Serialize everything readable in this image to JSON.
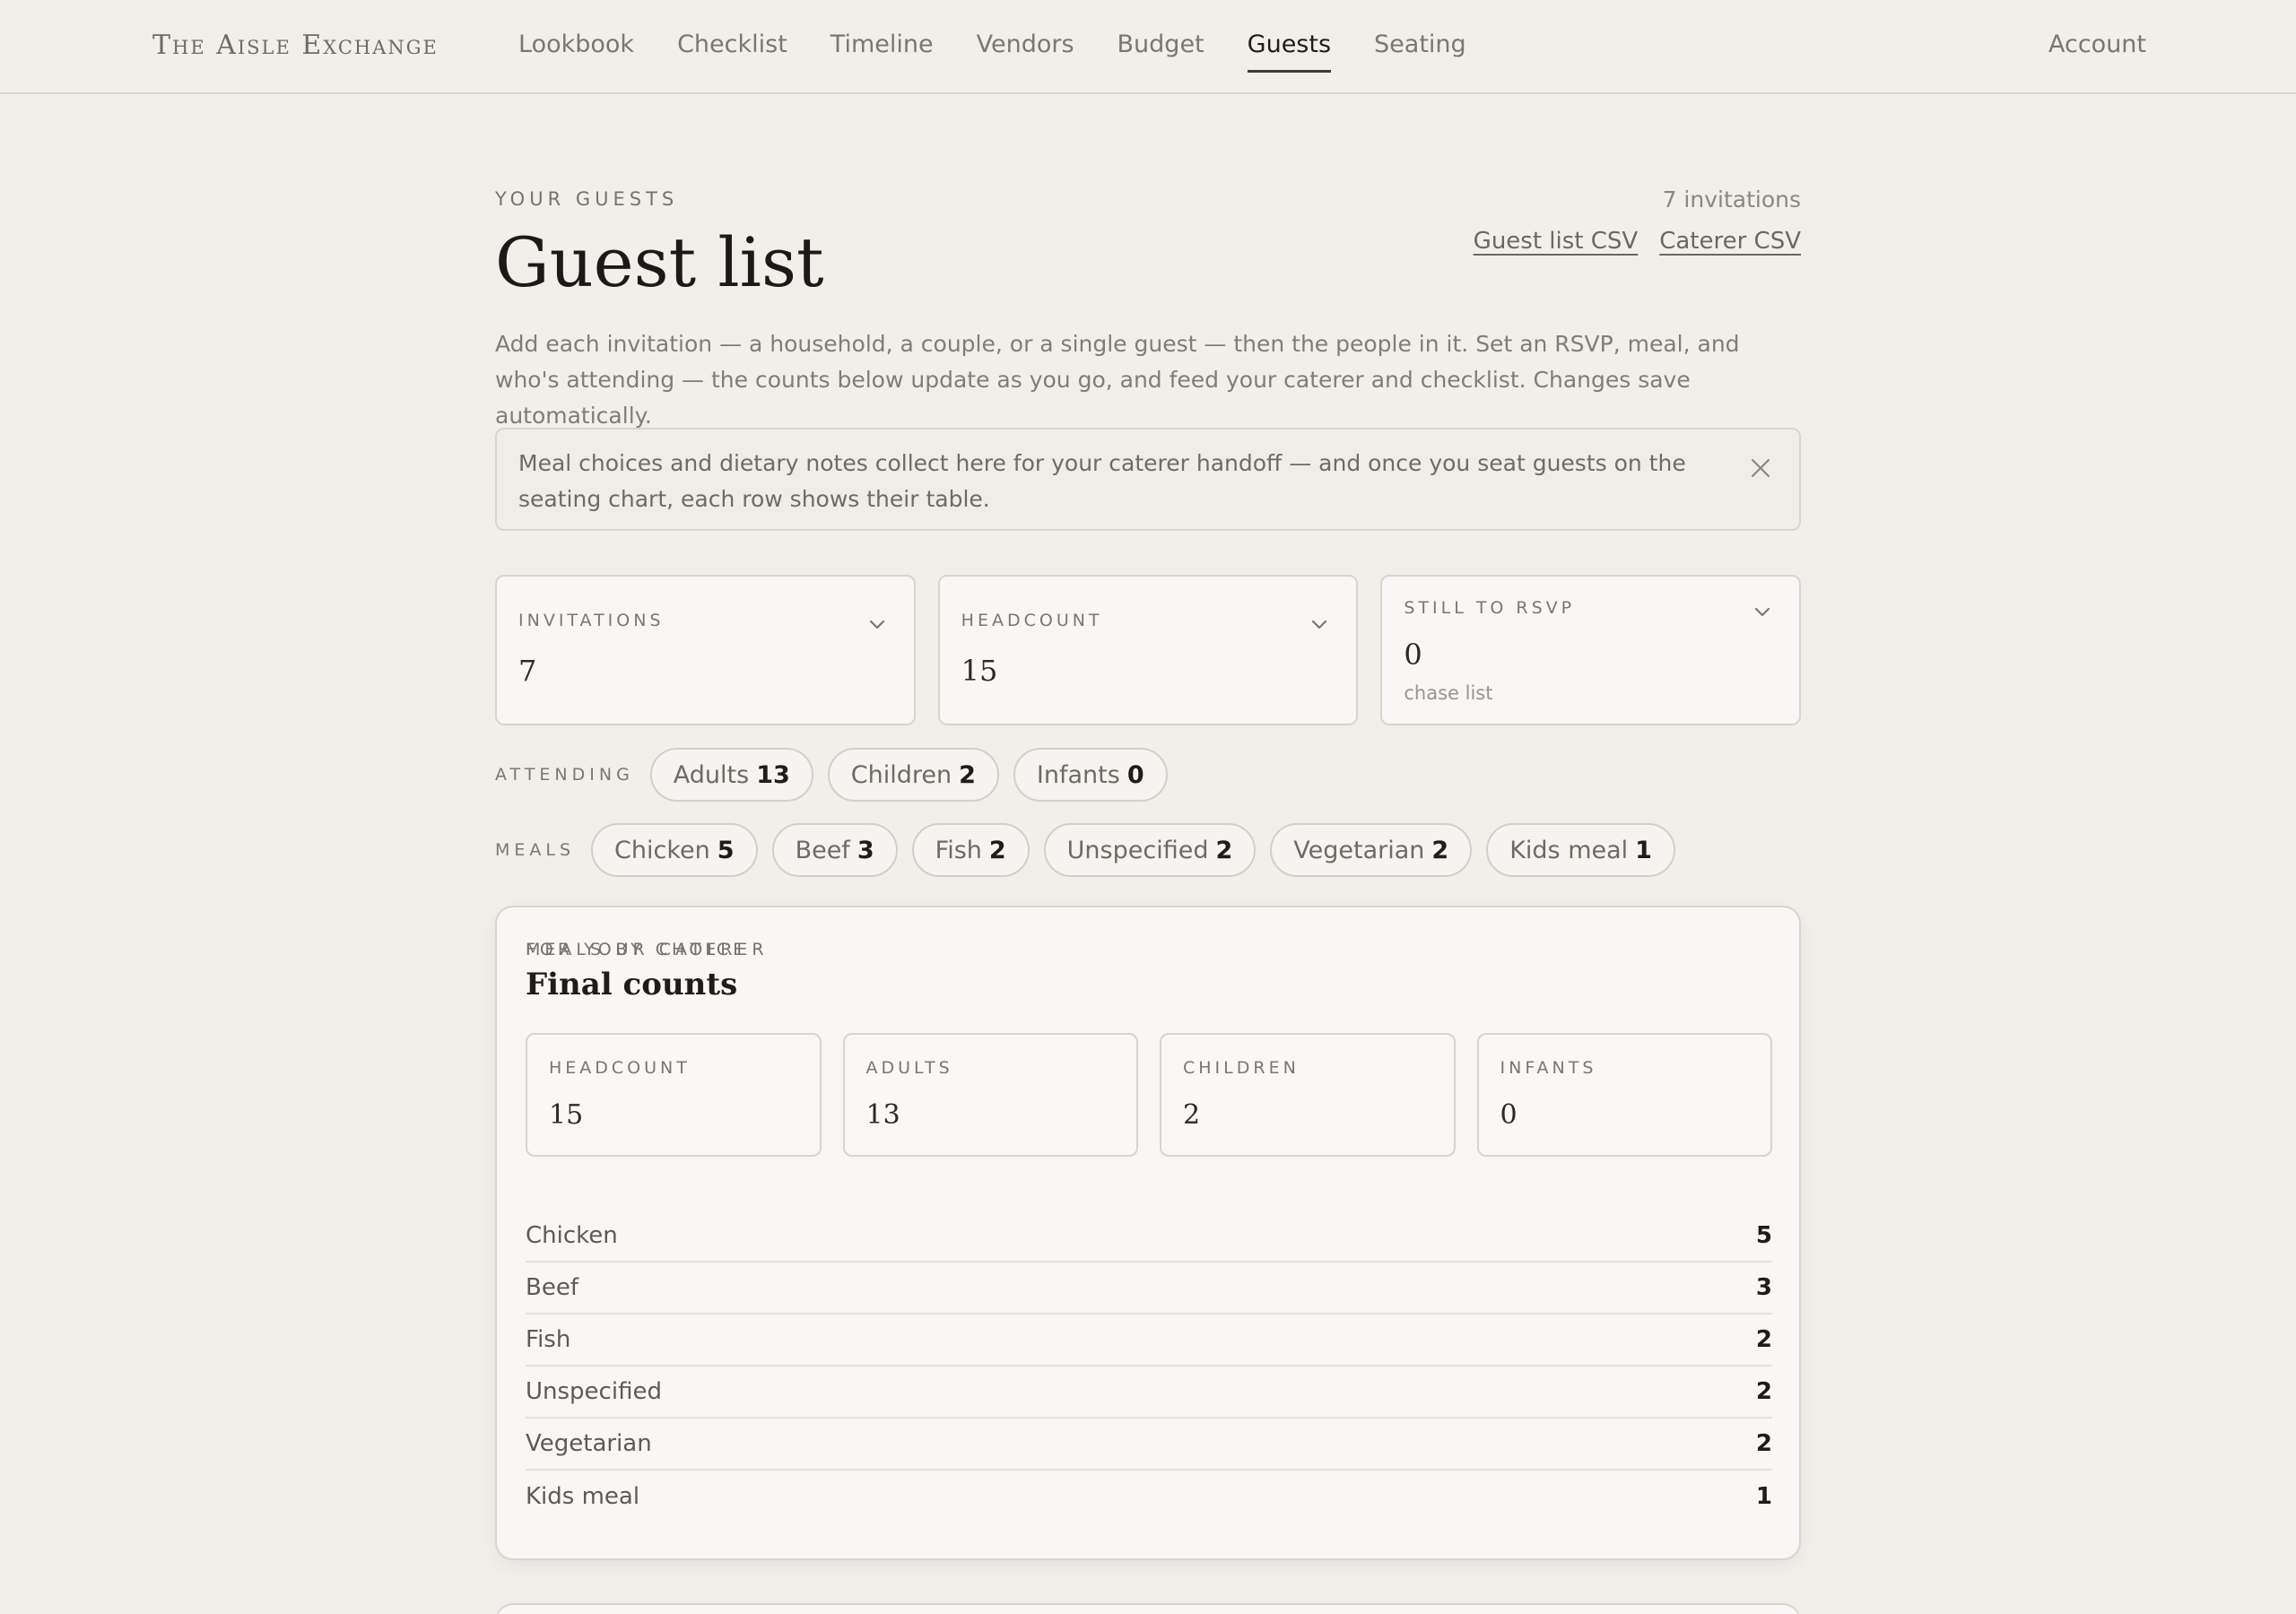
{
  "nav": {
    "brand": "The Aisle Exchange",
    "links": [
      "Lookbook",
      "Checklist",
      "Timeline",
      "Vendors",
      "Budget",
      "Guests",
      "Seating"
    ],
    "active": "Guests",
    "account": "Account"
  },
  "header": {
    "kicker": "YOUR GUESTS",
    "title": "Guest list",
    "invitation_count": "7 invitations",
    "csv_guest": "Guest list CSV",
    "csv_caterer": "Caterer CSV",
    "intro": "Add each invitation — a household, a couple, or a single guest — then the people in it. Set an RSVP, meal, and who's attending — the counts below update as you go, and feed your caterer and checklist. Changes save automatically."
  },
  "notice": {
    "text": "Meal choices and dietary notes collect here for your caterer handoff — and once you seat guests on the seating chart, each row shows their table.",
    "close_icon": "close-icon"
  },
  "stats": [
    {
      "label": "INVITATIONS",
      "value": "7"
    },
    {
      "label": "HEADCOUNT",
      "value": "15"
    },
    {
      "label": "STILL TO RSVP",
      "value": "0",
      "sub": "chase list"
    }
  ],
  "attending": {
    "label": "ATTENDING",
    "chips": [
      {
        "name": "Adults",
        "count": "13"
      },
      {
        "name": "Children",
        "count": "2"
      },
      {
        "name": "Infants",
        "count": "0"
      }
    ]
  },
  "meals": {
    "label": "MEALS",
    "chips": [
      {
        "name": "Chicken",
        "count": "5"
      },
      {
        "name": "Beef",
        "count": "3"
      },
      {
        "name": "Fish",
        "count": "2"
      },
      {
        "name": "Unspecified",
        "count": "2"
      },
      {
        "name": "Vegetarian",
        "count": "2"
      },
      {
        "name": "Kids meal",
        "count": "1"
      }
    ]
  },
  "caterer": {
    "eyebrow": "FOR YOUR CATERER",
    "title": "Final counts",
    "cards": [
      {
        "label": "HEADCOUNT",
        "value": "15"
      },
      {
        "label": "ADULTS",
        "value": "13"
      },
      {
        "label": "CHILDREN",
        "value": "2"
      },
      {
        "label": "INFANTS",
        "value": "0"
      }
    ],
    "meals_label": "MEALS BY CHOICE",
    "meals": [
      {
        "name": "Chicken",
        "count": "5"
      },
      {
        "name": "Beef",
        "count": "3"
      },
      {
        "name": "Fish",
        "count": "2"
      },
      {
        "name": "Unspecified",
        "count": "2"
      },
      {
        "name": "Vegetarian",
        "count": "2"
      },
      {
        "name": "Kids meal",
        "count": "1"
      }
    ]
  }
}
